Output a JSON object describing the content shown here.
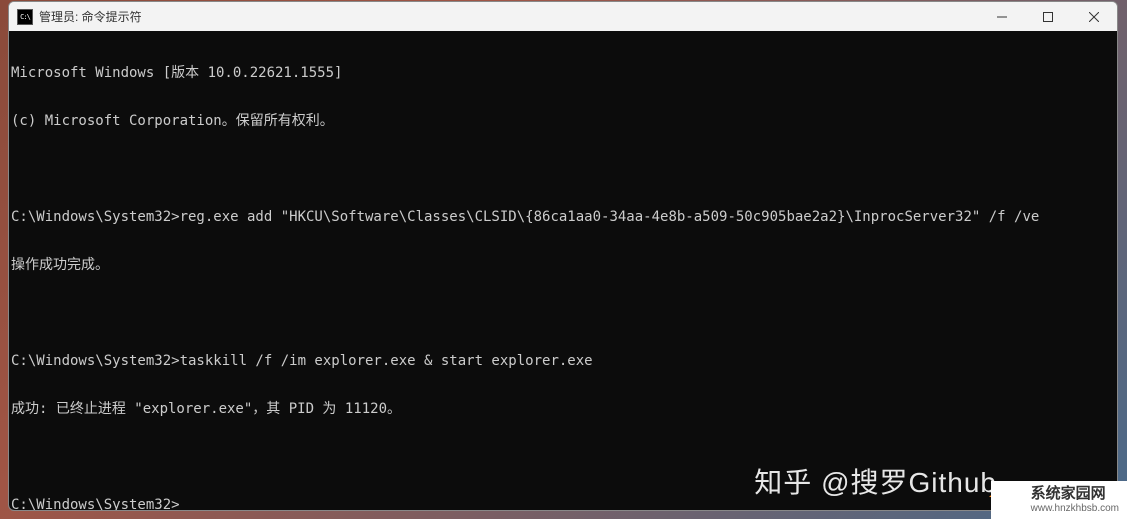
{
  "window": {
    "title": "管理员: 命令提示符",
    "icon_label": "C:\\"
  },
  "terminal": {
    "lines": [
      "Microsoft Windows [版本 10.0.22621.1555]",
      "(c) Microsoft Corporation。保留所有权利。",
      "",
      "C:\\Windows\\System32>reg.exe add \"HKCU\\Software\\Classes\\CLSID\\{86ca1aa0-34aa-4e8b-a509-50c905bae2a2}\\InprocServer32\" /f /ve",
      "操作成功完成。",
      "",
      "C:\\Windows\\System32>taskkill /f /im explorer.exe & start explorer.exe",
      "成功: 已终止进程 \"explorer.exe\"，其 PID 为 11120。",
      "",
      "C:\\Windows\\System32>"
    ]
  },
  "watermarks": {
    "zhihu": "知乎 @搜罗Github",
    "site_name": "系统家园网",
    "site_url": "www.hnzkhbsb.com"
  }
}
